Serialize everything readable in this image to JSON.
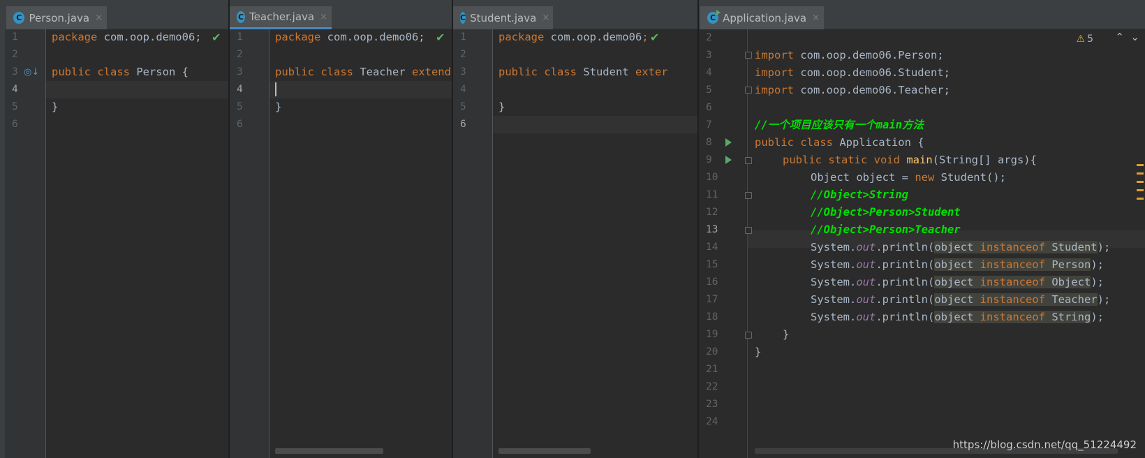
{
  "panes": [
    {
      "tab": {
        "icon": "class-icon",
        "label": "Person.java",
        "close": "×",
        "active": false
      },
      "lines": [
        "1",
        "2",
        "3",
        "4",
        "5",
        "6"
      ],
      "code": {
        "l1a": "package",
        "l1b": " com.oop.demo06;",
        "l3a": "public class",
        "l3b": " Person {",
        "l5": "}"
      }
    },
    {
      "tab": {
        "icon": "class-icon",
        "label": "Teacher.java",
        "close": "×",
        "active": true
      },
      "lines": [
        "1",
        "2",
        "3",
        "4",
        "5",
        "6"
      ],
      "code": {
        "l1a": "package",
        "l1b": " com.oop.demo06;",
        "l3a": "public class",
        "l3b": " Teacher ",
        "l3c": "extend",
        "l5": "}"
      }
    },
    {
      "tab": {
        "icon": "class-icon",
        "label": "Student.java",
        "close": "×",
        "active": false
      },
      "lines": [
        "1",
        "2",
        "3",
        "4",
        "5",
        "6"
      ],
      "code": {
        "l1a": "package",
        "l1b": " com.oop.demo06",
        "l3a": "public class",
        "l3b": " Student ",
        "l3c": "exter",
        "l5": "}"
      }
    },
    {
      "tab": {
        "icon": "class-icon",
        "label": "Application.java",
        "close": "×",
        "active": false
      },
      "lines": [
        "2",
        "3",
        "4",
        "5",
        "6",
        "7",
        "8",
        "9",
        "10",
        "11",
        "12",
        "13",
        "14",
        "15",
        "16",
        "17",
        "18",
        "19",
        "20",
        "21",
        "22",
        "23",
        "24"
      ],
      "code": {
        "import": "import",
        "l3": " com.oop.demo06.Person;",
        "l4": " com.oop.demo06.Student;",
        "l5": " com.oop.demo06.Teacher;",
        "l7": "//一个项目应该只有一个main方法",
        "l8a": "public class",
        "l8b": " Application {",
        "l9a": "public static void",
        "l9b": "main",
        "l9c": "(String[] args){",
        "l10a": "Object object = ",
        "l10b": "new",
        "l10c": " Student();",
        "l11": "//Object>String",
        "l12": "//Object>Person>Student",
        "l13": "//Object>Person>Teacher",
        "sys": "System.",
        "out": "out",
        "println": ".println(",
        "obj": "object ",
        "inst": "instanceof",
        "types": [
          " Student",
          " Person",
          " Object",
          " Teacher",
          " String"
        ],
        "end": ");",
        "l19": "}",
        "l20": "}"
      },
      "inspection": {
        "icon": "warning-icon",
        "count": "5"
      }
    }
  ],
  "watermark": "https://blog.csdn.net/qq_51224492",
  "colors": {
    "keyword": "#cc7832",
    "comment": "#00e000",
    "static_field": "#9876aa",
    "method": "#ffc66d",
    "text": "#a9b7c6"
  }
}
